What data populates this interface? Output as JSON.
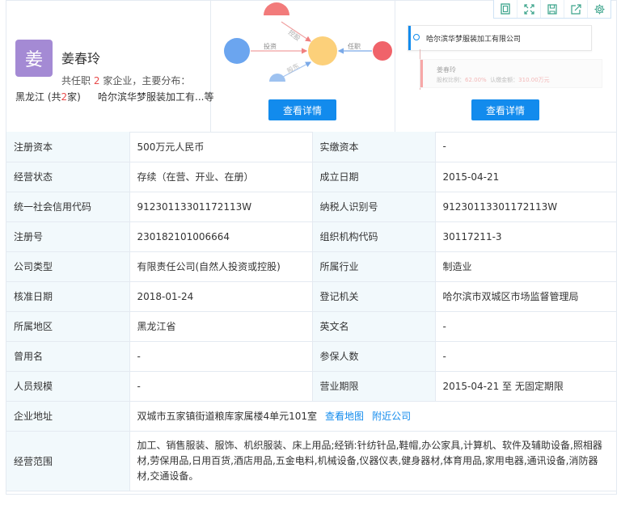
{
  "toolbar": {
    "icons": [
      "copy-icon",
      "fullscreen-icon",
      "save-icon",
      "share-icon",
      "settings-icon"
    ]
  },
  "person": {
    "avatar_char": "姜",
    "name": "姜春玲",
    "jobs_prefix": "共任职",
    "jobs_count": "2",
    "jobs_suffix": "家企业，主要分布：",
    "region": "黑龙江",
    "region_paren_open": " (共",
    "region_count": "2",
    "region_paren_close": "家)",
    "companies": "哈尔滨华梦服装加工有...等"
  },
  "graph": {
    "labels": {
      "invest": "投资",
      "hold": "控股",
      "job": "任职",
      "other": "股东"
    },
    "button": "查看详情"
  },
  "tree": {
    "company": "哈尔滨华梦服装加工有限公司",
    "person": "姜春玲",
    "ratio_label": "股权比例：",
    "ratio_value": "62.00%",
    "amount_label": "认缴金额：",
    "amount_value": "310.00万元",
    "button": "查看详情"
  },
  "table": {
    "reg_capital_label": "注册资本",
    "reg_capital_value": "500万元人民币",
    "paid_capital_label": "实缴资本",
    "paid_capital_value": "-",
    "status_label": "经营状态",
    "status_value": "存续（在营、开业、在册）",
    "founded_label": "成立日期",
    "founded_value": "2015-04-21",
    "credit_code_label": "统一社会信用代码",
    "credit_code_value": "91230113301172113W",
    "taxpayer_label": "纳税人识别号",
    "taxpayer_value": "91230113301172113W",
    "reg_no_label": "注册号",
    "reg_no_value": "230182101006664",
    "org_code_label": "组织机构代码",
    "org_code_value": "30117211-3",
    "type_label": "公司类型",
    "type_value": "有限责任公司(自然人投资或控股)",
    "industry_label": "所属行业",
    "industry_value": "制造业",
    "approval_label": "核准日期",
    "approval_value": "2018-01-24",
    "authority_label": "登记机关",
    "authority_value": "哈尔滨市双城区市场监督管理局",
    "region_label": "所属地区",
    "region_value": "黑龙江省",
    "english_label": "英文名",
    "english_value": "-",
    "former_label": "曾用名",
    "former_value": "-",
    "insured_label": "参保人数",
    "insured_value": "-",
    "staff_label": "人员规模",
    "staff_value": "-",
    "term_label": "营业期限",
    "term_value": "2015-04-21 至 无固定期限",
    "address_label": "企业地址",
    "address_value": "双城市五家镇街道粮库家属楼4单元101室",
    "map_link": "查看地图",
    "nearby_link": "附近公司",
    "scope_label": "经营范围",
    "scope_value": "加工、销售服装、服饰、机织服装、床上用品;经销:针纺针品,鞋帽,办公家具,计算机、软件及辅助设备,照相器材,劳保用品,日用百货,酒店用品,五金电料,机械设备,仪器仪表,健身器材,体育用品,家用电器,通讯设备,消防器材,交通设备。"
  }
}
